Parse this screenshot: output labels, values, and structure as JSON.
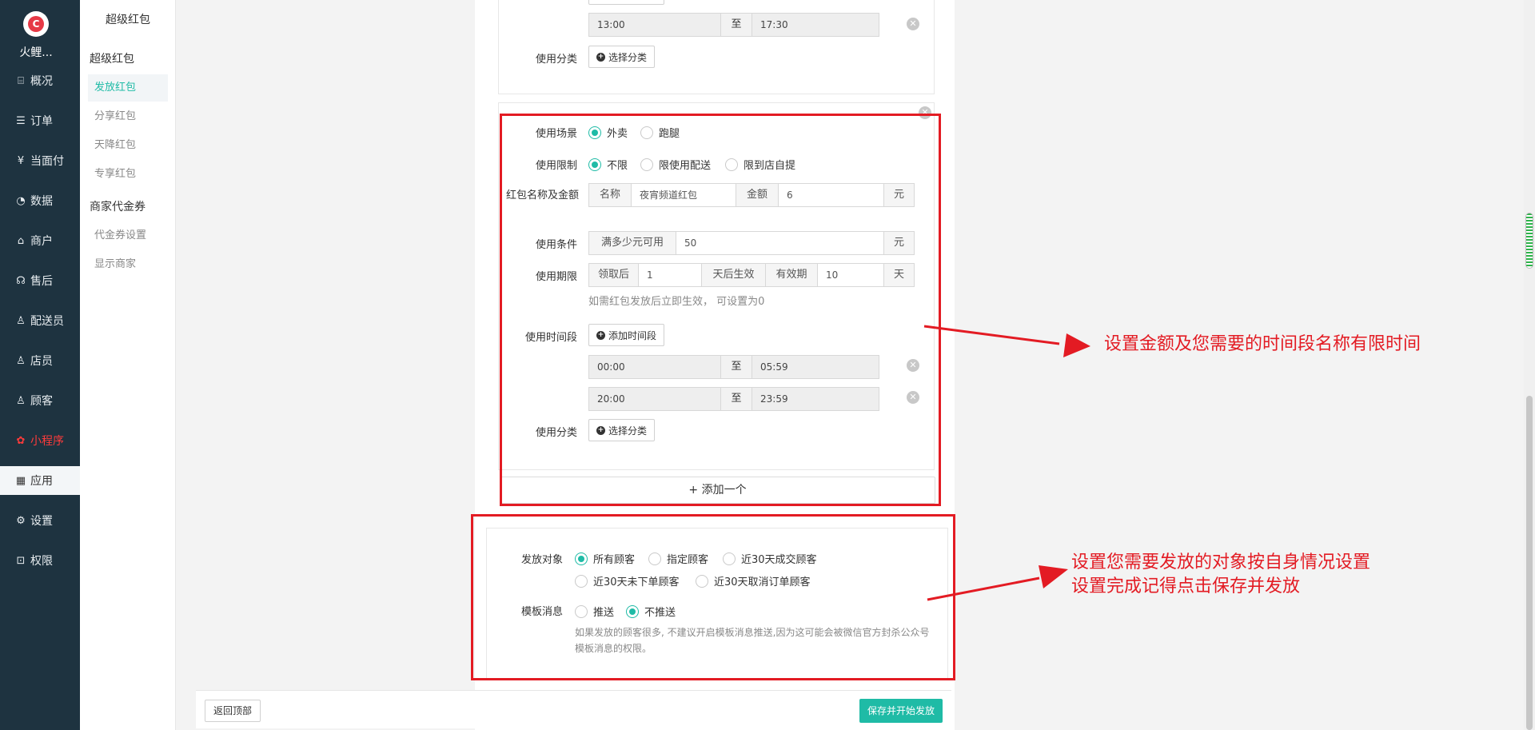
{
  "brand": "火鲤...",
  "nav": [
    {
      "icon": "overview-icon",
      "label": "概况"
    },
    {
      "icon": "order-icon",
      "label": "订单"
    },
    {
      "icon": "pay-icon",
      "label": "当面付"
    },
    {
      "icon": "data-icon",
      "label": "数据"
    },
    {
      "icon": "store-icon",
      "label": "商户"
    },
    {
      "icon": "aftersale-icon",
      "label": "售后"
    },
    {
      "icon": "courier-icon",
      "label": "配送员"
    },
    {
      "icon": "clerk-icon",
      "label": "店员"
    },
    {
      "icon": "customer-icon",
      "label": "顾客"
    },
    {
      "icon": "miniprogram-icon",
      "label": "小程序"
    },
    {
      "icon": "apps-icon",
      "label": "应用"
    },
    {
      "icon": "gear-icon",
      "label": "设置"
    },
    {
      "icon": "lock-icon",
      "label": "权限"
    }
  ],
  "submenu": {
    "title": "超级红包",
    "group1": "超级红包",
    "items1": [
      "发放红包",
      "分享红包",
      "天降红包",
      "专享红包"
    ],
    "group2": "商家代金券",
    "items2": [
      "代金券设置",
      "显示商家"
    ]
  },
  "card1": {
    "time_start": "13:00",
    "to": "至",
    "time_end": "17:30",
    "category_label": "使用分类",
    "category_btn": "选择分类"
  },
  "card2": {
    "scene_label": "使用场景",
    "scene_options": [
      "外卖",
      "跑腿"
    ],
    "limit_label": "使用限制",
    "limit_options": [
      "不限",
      "限使用配送",
      "限到店自提"
    ],
    "name_label": "红包名称及金额",
    "name_addon": "名称",
    "name_value": "夜宵频道红包",
    "amount_addon": "金额",
    "amount_value": "6",
    "unit_yuan": "元",
    "cond_label": "使用条件",
    "cond_addon": "满多少元可用",
    "cond_value": "50",
    "period_label": "使用期限",
    "after_addon": "领取后",
    "after_value": "1",
    "effective_addon": "天后生效",
    "valid_addon": "有效期",
    "valid_value": "10",
    "unit_day": "天",
    "period_hint": "如需红包发放后立即生效， 可设置为0",
    "timeslot_label": "使用时间段",
    "add_timeslot_btn": "添加时间段",
    "slot1_start": "00:00",
    "slot1_end": "05:59",
    "slot2_start": "20:00",
    "slot2_end": "23:59",
    "category_label": "使用分类",
    "category_btn": "选择分类"
  },
  "add_one": "+ 添加一个",
  "target": {
    "label": "发放对象",
    "options": [
      "所有顾客",
      "指定顾客",
      "近30天成交顾客",
      "近30天未下单顾客",
      "近30天取消订单顾客"
    ],
    "template_label": "模板消息",
    "template_options": [
      "推送",
      "不推送"
    ],
    "hint": "如果发放的顾客很多, 不建议开启模板消息推送,因为这可能会被微信官方封杀公众号模板消息的权限。"
  },
  "annotations": {
    "a1": "设置金额及您需要的时间段名称有限时间",
    "a2_line1": "设置您需要发放的对象按自身情况设置",
    "a2_line2": "设置完成记得点击保存并发放"
  },
  "footer": {
    "back_top": "返回顶部",
    "save": "保存并开始发放"
  },
  "colors": {
    "accent": "#1fbba6",
    "nav_bg": "#1e3340",
    "annotation": "#e31b23"
  }
}
